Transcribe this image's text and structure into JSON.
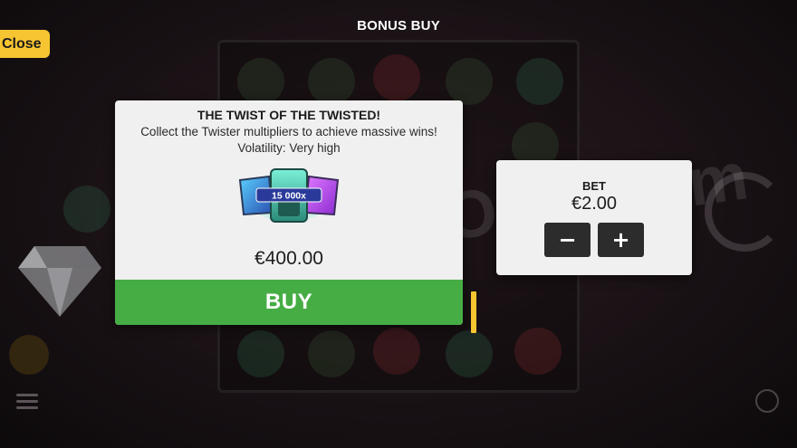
{
  "header": {
    "close_label": "Close",
    "title": "BONUS BUY"
  },
  "offer": {
    "title": "THE TWIST OF THE TWISTED!",
    "description": "Collect the Twister multipliers to achieve massive wins!",
    "volatility": "Volatility: Very high",
    "badge_text": "15 000x",
    "price": "€400.00",
    "buy_label": "BUY"
  },
  "bet": {
    "label": "BET",
    "value": "€2.00",
    "decrease_label": "−",
    "increase_label": "+"
  },
  "watermark": "ABOUTSLOTS.com",
  "colors": {
    "accent_yellow": "#f7c531",
    "buy_green": "#46ad45",
    "card_bg": "#f0f0f0",
    "stepper_bg": "#2c2c2c"
  }
}
